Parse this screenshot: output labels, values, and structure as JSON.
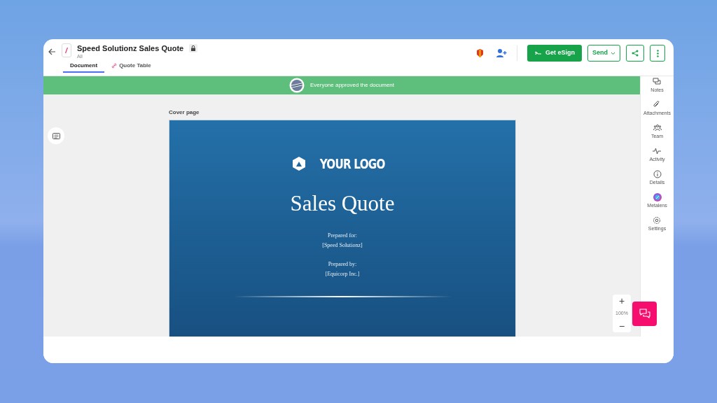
{
  "header": {
    "title": "Speed Solutionz Sales Quote",
    "subtitle": "All",
    "locked": true
  },
  "tabs": [
    {
      "label": "Document",
      "selected": true,
      "kind": "plain"
    },
    {
      "label": "Quote Table",
      "selected": false,
      "kind": "link"
    }
  ],
  "actions": {
    "esign": "Get eSign",
    "send": "Send"
  },
  "banner": {
    "message": "Everyone approved the document"
  },
  "section_label": "Cover page",
  "cover": {
    "logo": "YOUR LOGO",
    "title": "Sales Quote",
    "prepared_for_label": "Prepared for:",
    "prepared_for": "[Speed Solutionz]",
    "prepared_by_label": "Prepared by:",
    "prepared_by": "[Equicorp Inc.]"
  },
  "side_panel": [
    {
      "label": "Notes",
      "kind": "notes"
    },
    {
      "label": "Attachments",
      "kind": "attachments"
    },
    {
      "label": "Team",
      "kind": "team"
    },
    {
      "label": "Activity",
      "kind": "activity"
    },
    {
      "label": "Details",
      "kind": "details"
    },
    {
      "label": "Metalens",
      "kind": "metalens"
    },
    {
      "label": "Settings",
      "kind": "settings"
    }
  ],
  "zoom": {
    "plus": "+",
    "level": "100%",
    "minus": "−"
  }
}
